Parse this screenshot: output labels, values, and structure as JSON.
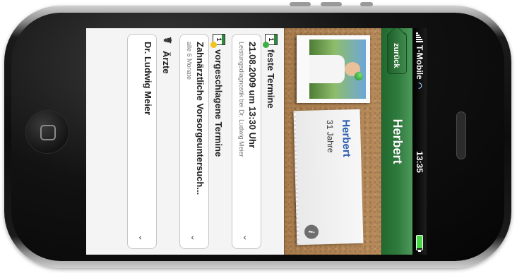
{
  "status_bar": {
    "carrier": "T-Mobile",
    "time": "13:35"
  },
  "nav": {
    "back_label": "zurück",
    "title": "Herbert"
  },
  "profile": {
    "name": "Herbert",
    "age": "31 Jahre"
  },
  "sections": {
    "fixed": {
      "title": "feste Termine",
      "icon_label": "1",
      "item_title": "21.08.2009 um 13:30 Uhr",
      "item_subtitle": "Leistungsdiagnostik bei Dr. Ludwig Meier"
    },
    "suggested": {
      "title": "vorgeschlagene Termine",
      "icon_label": "1",
      "item_title": "Zahnärztliche Vorsorgeuntersuch...",
      "item_subtitle": "alle 6 Monate"
    },
    "doctors": {
      "title": "Ärzte",
      "item_title": "Dr. Ludwig Meier"
    }
  },
  "colors": {
    "nav_green": "#2e7a3c",
    "fixed_dot": "#3cb043",
    "suggested_dot": "#f0c419"
  },
  "icons": {
    "info": "i",
    "chevron": "⌄",
    "stethoscope": "☤"
  }
}
